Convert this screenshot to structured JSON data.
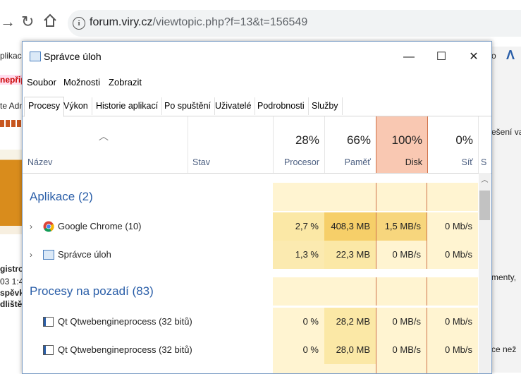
{
  "browser": {
    "url_host": "forum.viry.cz",
    "url_path": "/viewtopic.php?f=13&t=156549",
    "left_partial": [
      "plikac",
      "nepřip",
      "te Adn",
      "gistro",
      "03 1:4",
      "spěvk",
      "dliště"
    ],
    "right_partial": [
      "o",
      "ešení va",
      "menty,",
      "ce než"
    ]
  },
  "window": {
    "title": "Správce úloh",
    "menu": [
      "Soubor",
      "Možnosti",
      "Zobrazit"
    ],
    "tabs": [
      "Procesy",
      "Výkon",
      "Historie aplikací",
      "Po spuštění",
      "Uživatelé",
      "Podrobnosti",
      "Služby"
    ],
    "columns": {
      "name": "Název",
      "status": "Stav",
      "cpu": {
        "pct": "28%",
        "label": "Procesor"
      },
      "mem": {
        "pct": "66%",
        "label": "Paměť"
      },
      "disk": {
        "pct": "100%",
        "label": "Disk"
      },
      "net": {
        "pct": "0%",
        "label": "Síť"
      },
      "extra": "S"
    },
    "groups": {
      "apps": "Aplikace (2)",
      "background": "Procesy na pozadí (83)"
    },
    "rows": [
      {
        "name": "Google Chrome (10)",
        "cpu": "2,7 %",
        "mem": "408,3 MB",
        "disk": "1,5 MB/s",
        "net": "0 Mb/s"
      },
      {
        "name": "Správce úloh",
        "cpu": "1,3 %",
        "mem": "22,3 MB",
        "disk": "0 MB/s",
        "net": "0 Mb/s"
      },
      {
        "name": "Qt Qtwebengineprocess (32 bitů)",
        "cpu": "0 %",
        "mem": "28,2 MB",
        "disk": "0 MB/s",
        "net": "0 Mb/s"
      },
      {
        "name": "Qt Qtwebengineprocess (32 bitů)",
        "cpu": "0 %",
        "mem": "28,0 MB",
        "disk": "0 MB/s",
        "net": "0 Mb/s"
      }
    ]
  }
}
